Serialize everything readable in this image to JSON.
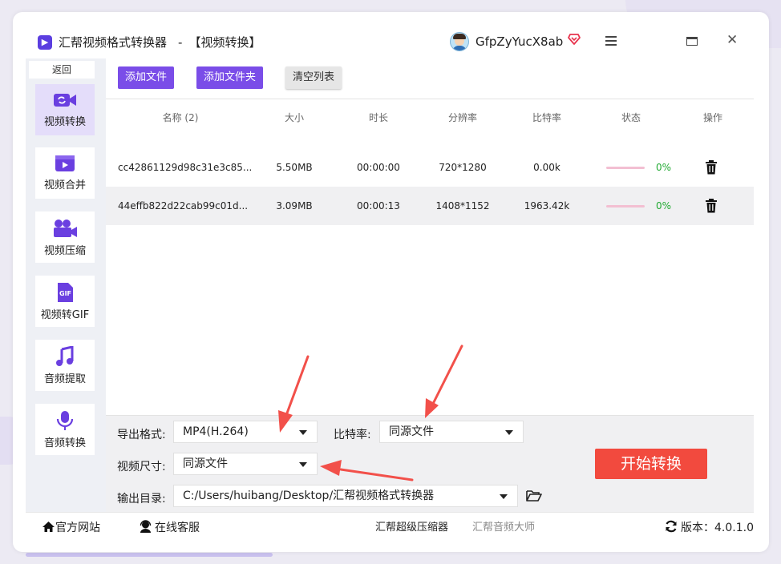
{
  "window": {
    "app_name": "汇帮视频格式转换器",
    "separator": "-",
    "section": "【视频转换】",
    "user_name": "GfpZyYucX8ab"
  },
  "sidebar": {
    "back_label": "返回",
    "items": [
      {
        "label": "视频转换",
        "icon": "video-convert-icon",
        "active": true
      },
      {
        "label": "视频合并",
        "icon": "video-merge-icon"
      },
      {
        "label": "视频压缩",
        "icon": "video-compress-icon"
      },
      {
        "label": "视频转GIF",
        "icon": "gif-icon"
      },
      {
        "label": "音频提取",
        "icon": "music-icon"
      },
      {
        "label": "音频转换",
        "icon": "microphone-icon"
      }
    ]
  },
  "toolbar": {
    "add_file": "添加文件",
    "add_folder": "添加文件夹",
    "clear_list": "清空列表"
  },
  "table": {
    "headers": {
      "name": "名称 (2)",
      "size": "大小",
      "duration": "时长",
      "resolution": "分辨率",
      "bitrate": "比特率",
      "status": "状态",
      "action": "操作"
    },
    "rows": [
      {
        "name": "cc42861129d98c31e3c85...",
        "size": "5.50MB",
        "duration": "00:00:00",
        "resolution": "720*1280",
        "bitrate": "0.00k",
        "progress": "0%"
      },
      {
        "name": "44effb822d22cab99c01d...",
        "size": "3.09MB",
        "duration": "00:00:13",
        "resolution": "1408*1152",
        "bitrate": "1963.42k",
        "progress": "0%"
      }
    ]
  },
  "settings": {
    "format_label": "导出格式:",
    "format_value": "MP4(H.264)",
    "bitrate_label": "比特率:",
    "bitrate_value": "同源文件",
    "size_label": "视频尺寸:",
    "size_value": "同源文件",
    "output_label": "输出目录:",
    "output_value": "C:/Users/huibang/Desktop/汇帮视频格式转换器",
    "start_button": "开始转换"
  },
  "footer": {
    "website": "官方网站",
    "support": "在线客服",
    "compressor": "汇帮超级压缩器",
    "audio_master": "汇帮音频大师",
    "version_label": "版本：",
    "version_value": "4.0.1.0"
  },
  "colors": {
    "accent_purple": "#7a4de8",
    "start_red": "#f24a3e",
    "progress_green": "#22aa33",
    "annotation_red": "#f2504a"
  }
}
